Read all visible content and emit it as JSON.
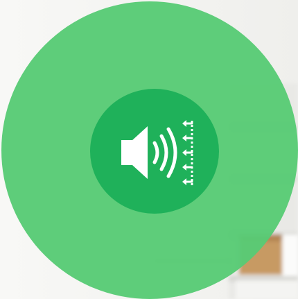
{
  "colors": {
    "outer_disc": "#57cb75",
    "inner_disc": "#1fb15a",
    "icon": "#ffffff",
    "background": "#f6f6f4"
  },
  "icon": {
    "name": "speaker-sound-absorption-icon",
    "arrow_count": 5
  }
}
